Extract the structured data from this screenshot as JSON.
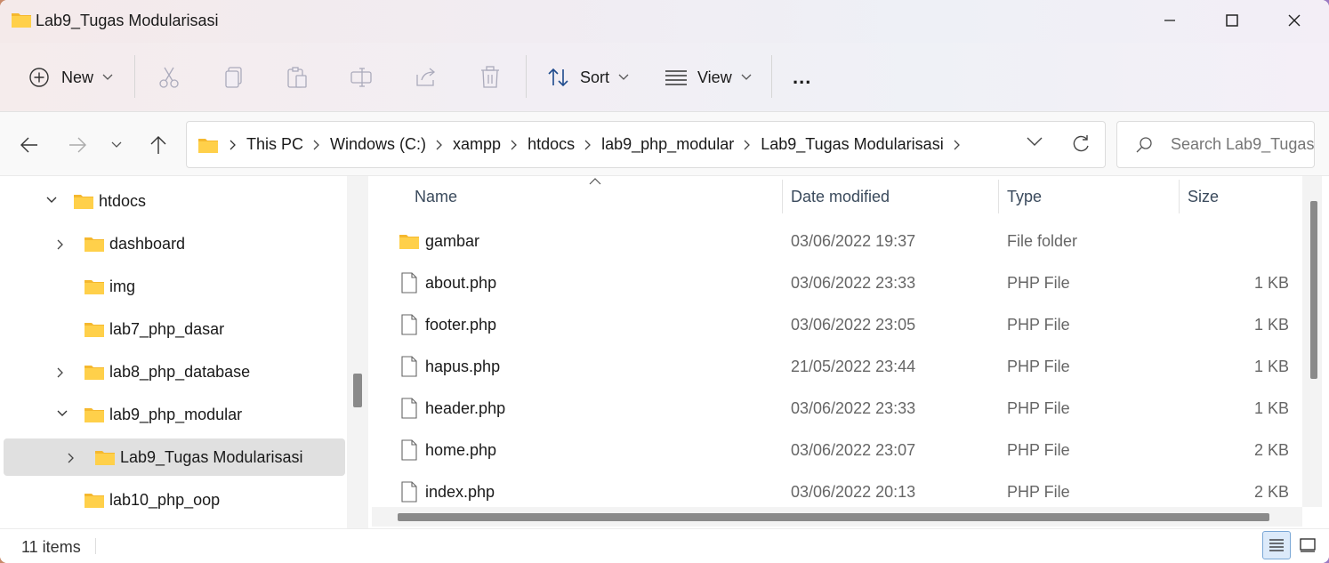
{
  "window": {
    "title": "Lab9_Tugas Modularisasi",
    "minimize_icon": "minimize-icon",
    "maximize_icon": "maximize-icon",
    "close_icon": "close-icon"
  },
  "toolbar": {
    "new_label": "New",
    "sort_label": "Sort",
    "view_label": "View",
    "more_label": "..."
  },
  "address": {
    "crumbs": [
      "This PC",
      "Windows (C:)",
      "xampp",
      "htdocs",
      "lab9_php_modular",
      "Lab9_Tugas Modularisasi"
    ],
    "search_placeholder": "Search Lab9_Tugas..."
  },
  "sidebar": {
    "items": [
      {
        "label": "htdocs",
        "expanded": true
      },
      {
        "label": "dashboard",
        "expanded": false
      },
      {
        "label": "img",
        "expanded": null
      },
      {
        "label": "lab7_php_dasar",
        "expanded": null
      },
      {
        "label": "lab8_php_database",
        "expanded": false
      },
      {
        "label": "lab9_php_modular",
        "expanded": true
      },
      {
        "label": "Lab9_Tugas Modularisasi",
        "expanded": false,
        "selected": true
      },
      {
        "label": "lab10_php_oop",
        "expanded": null
      }
    ]
  },
  "columns": {
    "name": "Name",
    "date": "Date modified",
    "type": "Type",
    "size": "Size"
  },
  "files": [
    {
      "name": "gambar",
      "date": "03/06/2022 19:37",
      "type": "File folder",
      "size": "",
      "kind": "folder"
    },
    {
      "name": "about.php",
      "date": "03/06/2022 23:33",
      "type": "PHP File",
      "size": "1 KB",
      "kind": "file"
    },
    {
      "name": "footer.php",
      "date": "03/06/2022 23:05",
      "type": "PHP File",
      "size": "1 KB",
      "kind": "file"
    },
    {
      "name": "hapus.php",
      "date": "21/05/2022 23:44",
      "type": "PHP File",
      "size": "1 KB",
      "kind": "file"
    },
    {
      "name": "header.php",
      "date": "03/06/2022 23:33",
      "type": "PHP File",
      "size": "1 KB",
      "kind": "file"
    },
    {
      "name": "home.php",
      "date": "03/06/2022 23:07",
      "type": "PHP File",
      "size": "2 KB",
      "kind": "file"
    },
    {
      "name": "index.php",
      "date": "03/06/2022 20:13",
      "type": "PHP File",
      "size": "2 KB",
      "kind": "file"
    }
  ],
  "status": {
    "item_count": "11 items"
  },
  "colors": {
    "folder": "#f8c844",
    "accent": "#0067c0",
    "selected_bg": "#e0e0e0"
  }
}
